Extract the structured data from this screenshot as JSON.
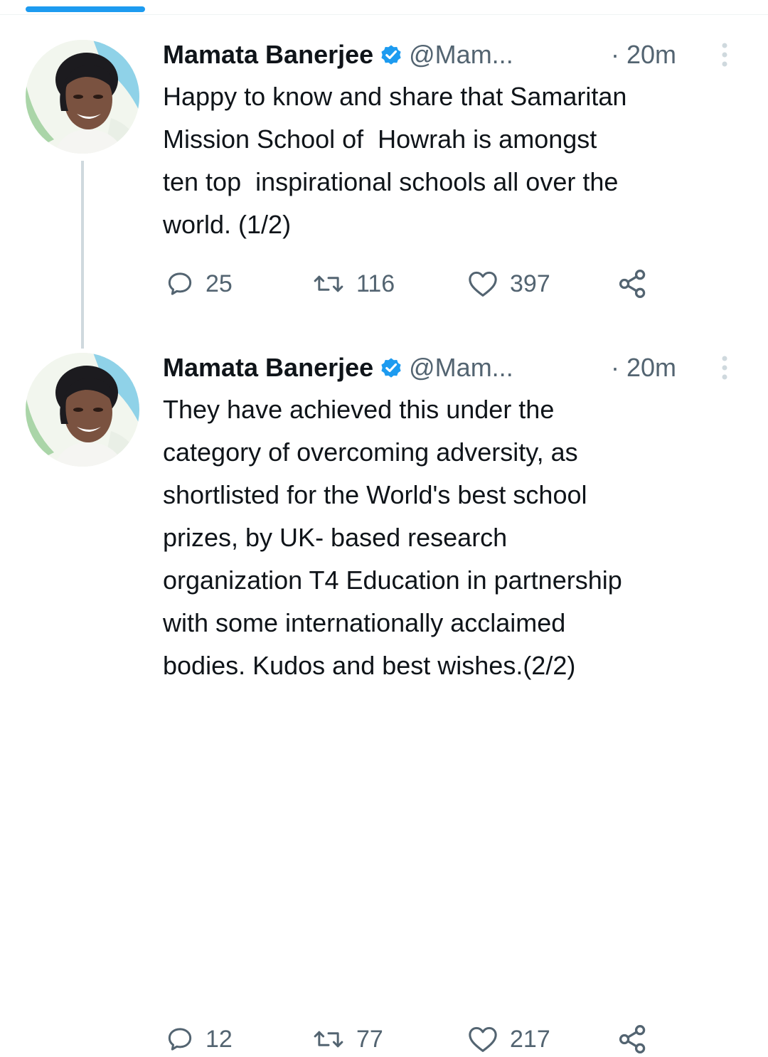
{
  "thread": [
    {
      "author": {
        "display_name": "Mamata Banerjee",
        "handle": "@Mam...",
        "verified": true
      },
      "time": "· 20m",
      "text": "Happy to know and share that Samaritan\nMission School of  Howrah is amongst\nten top  inspirational schools all over the\nworld. (1/2)",
      "stats": {
        "replies": "25",
        "retweets": "116",
        "likes": "397"
      }
    },
    {
      "author": {
        "display_name": "Mamata Banerjee",
        "handle": "@Mam...",
        "verified": true
      },
      "time": "· 20m",
      "text": "They have achieved this under the\ncategory of overcoming adversity, as\nshortlisted for the World's best school\nprizes, by UK- based research\norganization T4 Education in partnership\nwith some internationally acclaimed\nbodies. Kudos and best wishes.(2/2)",
      "stats": {
        "replies": "12",
        "retweets": "77",
        "likes": "217"
      }
    }
  ],
  "icons": {
    "reply": "reply-icon",
    "retweet": "retweet-icon",
    "like": "heart-icon",
    "share": "share-icon",
    "verified": "verified-badge-icon",
    "more": "more-options-icon"
  },
  "colors": {
    "accent": "#1d9bf0",
    "text_primary": "#0f1419",
    "text_secondary": "#536471",
    "thread_line": "#cfd9de"
  }
}
